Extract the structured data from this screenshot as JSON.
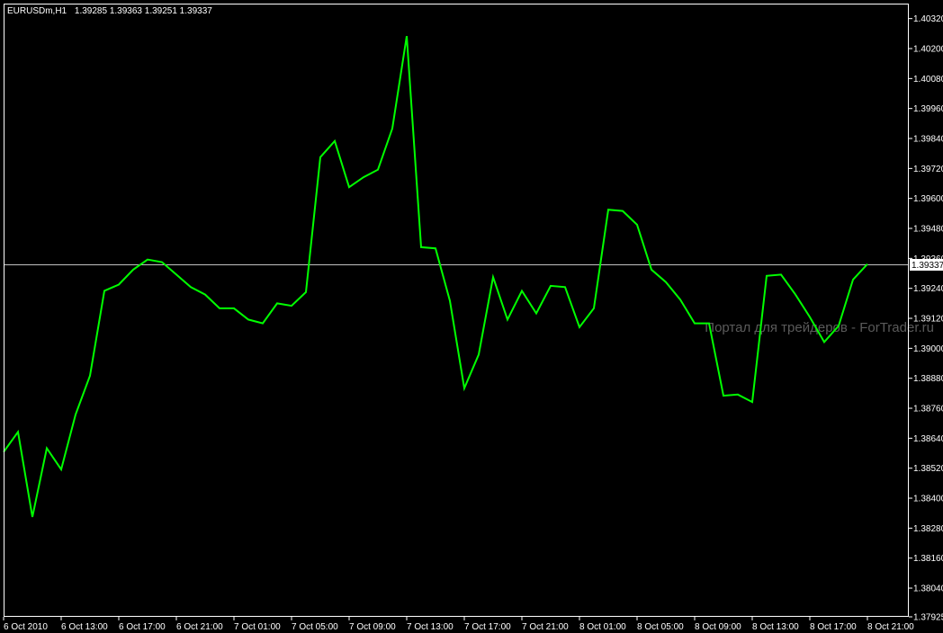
{
  "header": {
    "symbol": "EURUSDm,H1",
    "ohlc": "1.39285 1.39363 1.39251 1.39337"
  },
  "watermark": "Портал для трейдеров - ForTrader.ru",
  "colors": {
    "background": "#000000",
    "series": "#00ff00",
    "axis": "#ffffff",
    "price_line": "#c0c0c0",
    "watermark": "#5a5a5a"
  },
  "chart_data": {
    "type": "line",
    "title": "",
    "xlabel": "",
    "ylabel": "",
    "ylim": [
      1.37925,
      1.4038
    ],
    "grid": false,
    "current_price": "1.39337",
    "y_ticks": [
      "1.40320",
      "1.40200",
      "1.40080",
      "1.39960",
      "1.39840",
      "1.39720",
      "1.39600",
      "1.39480",
      "1.39360",
      "1.39240",
      "1.39120",
      "1.39000",
      "1.38880",
      "1.38760",
      "1.38640",
      "1.38520",
      "1.38400",
      "1.38280",
      "1.38160",
      "1.38040",
      "1.37925"
    ],
    "x_ticks": [
      {
        "label": "6 Oct 2010",
        "bar": 0
      },
      {
        "label": "6 Oct 13:00",
        "bar": 4
      },
      {
        "label": "6 Oct 17:00",
        "bar": 8
      },
      {
        "label": "6 Oct 21:00",
        "bar": 12
      },
      {
        "label": "7 Oct 01:00",
        "bar": 16
      },
      {
        "label": "7 Oct 05:00",
        "bar": 20
      },
      {
        "label": "7 Oct 09:00",
        "bar": 24
      },
      {
        "label": "7 Oct 13:00",
        "bar": 28
      },
      {
        "label": "7 Oct 17:00",
        "bar": 32
      },
      {
        "label": "7 Oct 21:00",
        "bar": 36
      },
      {
        "label": "8 Oct 01:00",
        "bar": 40
      },
      {
        "label": "8 Oct 05:00",
        "bar": 44
      },
      {
        "label": "8 Oct 09:00",
        "bar": 48
      },
      {
        "label": "8 Oct 13:00",
        "bar": 52
      },
      {
        "label": "8 Oct 17:00",
        "bar": 56
      },
      {
        "label": "8 Oct 21:00",
        "bar": 60
      }
    ],
    "series": [
      {
        "x": [
          0,
          1,
          2,
          3,
          4,
          5,
          6,
          7,
          8,
          9,
          10,
          11,
          12,
          13,
          14,
          15,
          16,
          17,
          18,
          19,
          20,
          21,
          22,
          23,
          24,
          25,
          26,
          27,
          28,
          29,
          30,
          31,
          32,
          33,
          34,
          35,
          36,
          37,
          38,
          39,
          40,
          41,
          42,
          43,
          44,
          45,
          46,
          47,
          48,
          49,
          50,
          51,
          52,
          53,
          54,
          55,
          56,
          57,
          58,
          59,
          60
        ],
        "values": [
          1.38585,
          1.38665,
          1.38325,
          1.386,
          1.38515,
          1.38735,
          1.3889,
          1.3923,
          1.39255,
          1.39315,
          1.39355,
          1.39345,
          1.39295,
          1.39245,
          1.39215,
          1.3916,
          1.3916,
          1.39115,
          1.391,
          1.3918,
          1.3917,
          1.39225,
          1.39765,
          1.3983,
          1.39645,
          1.39685,
          1.39715,
          1.3988,
          1.4025,
          1.39405,
          1.394,
          1.3919,
          1.3884,
          1.38975,
          1.39285,
          1.39115,
          1.3923,
          1.3914,
          1.3925,
          1.39245,
          1.39085,
          1.3916,
          1.39555,
          1.3955,
          1.39495,
          1.39315,
          1.39265,
          1.39195,
          1.391,
          1.391,
          1.3881,
          1.38815,
          1.38785,
          1.3929,
          1.39295,
          1.39215,
          1.39125,
          1.39025,
          1.3909,
          1.39275,
          1.39337
        ]
      }
    ]
  }
}
